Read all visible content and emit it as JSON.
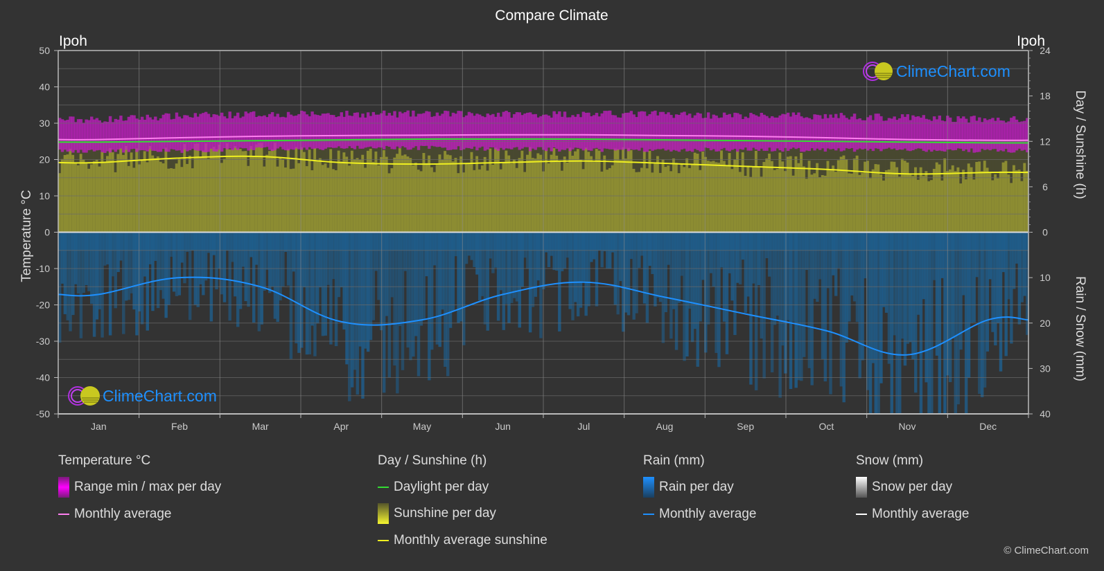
{
  "title": "Compare Climate",
  "location_left": "Ipoh",
  "location_right": "Ipoh",
  "watermark": "ClimeChart.com",
  "copyright": "© ClimeChart.com",
  "colors": {
    "background": "#333333",
    "temp_range": "#c21fc2",
    "temp_avg": "#ff7ff0",
    "daylight": "#33dd33",
    "sunshine_fill": "#8a8a30",
    "sunshine_avg": "#f0f020",
    "rain_fill": "#1e5f8f",
    "rain_avg": "#1e90ff",
    "grid": "#5a5a5a",
    "brand_blue": "#1e90ff"
  },
  "legend": {
    "temperature": {
      "title": "Temperature °C",
      "items": [
        "Range min / max per day",
        "Monthly average"
      ]
    },
    "sunshine": {
      "title": "Day / Sunshine (h)",
      "items": [
        "Daylight per day",
        "Sunshine per day",
        "Monthly average sunshine"
      ]
    },
    "rain": {
      "title": "Rain (mm)",
      "items": [
        "Rain per day",
        "Monthly average"
      ]
    },
    "snow": {
      "title": "Snow (mm)",
      "items": [
        "Snow per day",
        "Monthly average"
      ]
    }
  },
  "chart_data": {
    "type": "area",
    "title": "Compare Climate",
    "categories": [
      "Jan",
      "Feb",
      "Mar",
      "Apr",
      "May",
      "Jun",
      "Jul",
      "Aug",
      "Sep",
      "Oct",
      "Nov",
      "Dec"
    ],
    "axes": {
      "left": {
        "label": "Temperature °C",
        "range": [
          -50,
          50
        ],
        "ticks": [
          50,
          40,
          30,
          20,
          10,
          0,
          -10,
          -20,
          -30,
          -40,
          -50
        ]
      },
      "right_top": {
        "label": "Day / Sunshine (h)",
        "range": [
          0,
          24
        ],
        "ticks": [
          24,
          18,
          12,
          6,
          0
        ]
      },
      "right_bottom": {
        "label": "Rain / Snow (mm)",
        "range": [
          0,
          40
        ],
        "ticks": [
          0,
          10,
          20,
          30,
          40
        ]
      }
    },
    "grid": true,
    "series": [
      {
        "name": "Temperature range min (°C)",
        "axis": "left",
        "values": [
          23.0,
          23.0,
          23.5,
          23.8,
          23.8,
          23.5,
          23.3,
          23.3,
          23.3,
          23.3,
          23.3,
          23.0
        ]
      },
      {
        "name": "Temperature range max (°C)",
        "axis": "left",
        "values": [
          30.0,
          31.0,
          31.5,
          31.5,
          31.5,
          31.5,
          31.5,
          31.5,
          31.0,
          31.0,
          30.5,
          30.0
        ]
      },
      {
        "name": "Temperature monthly average (°C)",
        "axis": "left",
        "values": [
          25.5,
          26.0,
          26.4,
          26.6,
          26.7,
          26.8,
          26.8,
          26.6,
          26.4,
          26.0,
          25.5,
          25.3
        ]
      },
      {
        "name": "Daylight per day (h)",
        "axis": "right_top",
        "values": [
          11.9,
          12.0,
          12.1,
          12.2,
          12.3,
          12.3,
          12.3,
          12.2,
          12.1,
          12.0,
          11.9,
          11.8
        ]
      },
      {
        "name": "Monthly average sunshine (h)",
        "axis": "right_top",
        "values": [
          9.2,
          9.8,
          10.0,
          9.2,
          9.0,
          9.2,
          9.4,
          9.1,
          8.7,
          8.3,
          7.7,
          7.9
        ]
      },
      {
        "name": "Rain monthly average (mm)",
        "axis": "right_bottom",
        "values": [
          13.7,
          10.0,
          12.0,
          19.7,
          19.3,
          13.7,
          11.0,
          14.3,
          18.0,
          21.7,
          27.0,
          19.3
        ]
      },
      {
        "name": "Snow monthly average (mm)",
        "axis": "right_bottom",
        "values": [
          0,
          0,
          0,
          0,
          0,
          0,
          0,
          0,
          0,
          0,
          0,
          0
        ]
      }
    ]
  }
}
